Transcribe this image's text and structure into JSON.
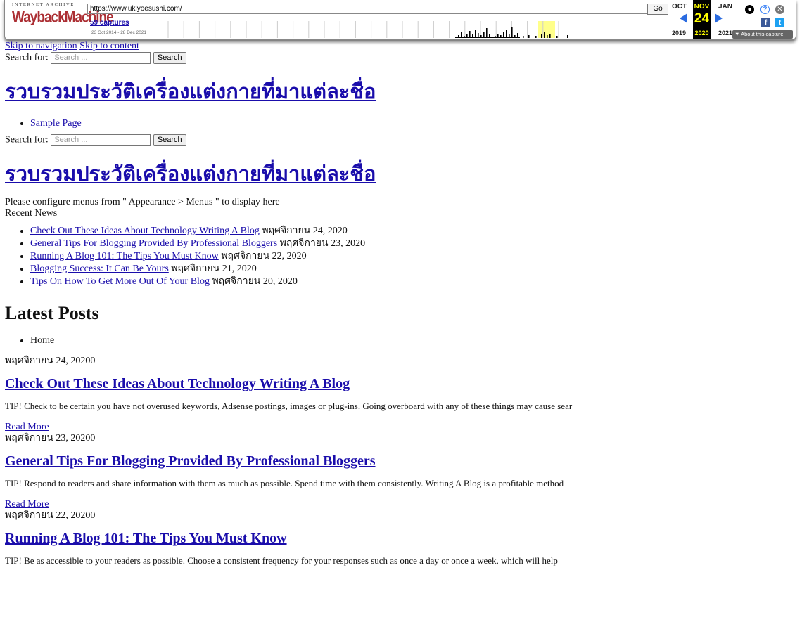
{
  "wayback": {
    "ia_label": "INTERNET ARCHIVE",
    "wb_label": "WaybackMachine",
    "url": "https://www.ukiyoesushi.com/",
    "go_label": "Go",
    "captures_label": "59 captures",
    "range_label": "23 Oct 2014 - 28 Dec 2021",
    "prev_month": "OCT",
    "cur_month": "NOV",
    "next_month": "JAN",
    "cur_day": "24",
    "prev_year": "2019",
    "cur_year": "2020",
    "next_year": "2021",
    "about_label": "▼ About this capture",
    "colors": {
      "brand_red": "#ab2e33",
      "nav_blue": "#2a6be0",
      "highlight": "#ffff00"
    }
  },
  "skip": {
    "nav": "Skip to navigation",
    "content": "Skip to content"
  },
  "search": {
    "label": "Search for:",
    "placeholder": "Search ...",
    "button": "Search"
  },
  "site_title": "รวบรวมประวัติเครื่องแต่งกายที่มาแต่ละชื่อ",
  "nav": {
    "sample_page": "Sample Page"
  },
  "menu_notice": "Please configure menus from \" Appearance > Menus \" to display here",
  "recent": {
    "heading": "Recent News",
    "items": [
      {
        "title": "Check Out These Ideas About Technology Writing A Blog",
        "date": " พฤศจิกายน 24, 2020"
      },
      {
        "title": "General Tips For Blogging Provided By Professional Bloggers",
        "date": " พฤศจิกายน 23, 2020"
      },
      {
        "title": "Running A Blog 101: The Tips You Must Know",
        "date": " พฤศจิกายน 22, 2020"
      },
      {
        "title": "Blogging Success: It Can Be Yours",
        "date": " พฤศจิกายน 21, 2020"
      },
      {
        "title": "Tips On How To Get More Out Of Your Blog",
        "date": " พฤศจิกายน 20, 2020"
      }
    ]
  },
  "latest": {
    "heading": "Latest Posts",
    "breadcrumb": "Home"
  },
  "posts": [
    {
      "meta": "พฤศจิกายน 24, 20200",
      "title": "Check Out These Ideas About Technology Writing A Blog",
      "excerpt": "TIP! Check to be certain you have not overused keywords, Adsense postings, images or plug-ins. Going overboard with any of these things may cause sear",
      "read_more": "Read More"
    },
    {
      "meta": "พฤศจิกายน 23, 20200",
      "title": "General Tips For Blogging Provided By Professional Bloggers",
      "excerpt": "TIP! Respond to readers and share information with them as much as possible. Spend time with them consistently. Writing A Blog is a profitable method",
      "read_more": "Read More"
    },
    {
      "meta": "พฤศจิกายน 22, 20200",
      "title": "Running A Blog 101: The Tips You Must Know",
      "excerpt": "TIP! Be as accessible to your readers as possible. Choose a consistent frequency for your responses such as once a day or once a week, which will help"
    }
  ]
}
